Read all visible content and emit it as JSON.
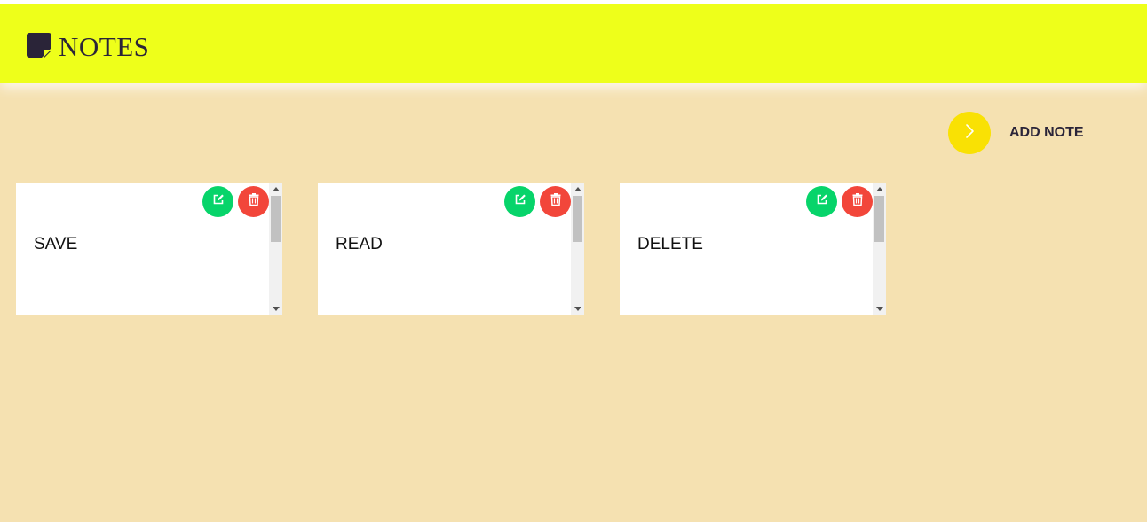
{
  "header": {
    "title": "NOTES",
    "background_color": "#eeff1a",
    "logo_icon": "sticky-note-icon"
  },
  "add_note": {
    "label": "ADD NOTE",
    "icon": "chevron-right-icon",
    "button_color": "#f9e104"
  },
  "notes": [
    {
      "text": "SAVE"
    },
    {
      "text": "READ"
    },
    {
      "text": "DELETE"
    }
  ],
  "note_actions": {
    "edit_icon": "edit-icon",
    "edit_color": "#07d46a",
    "delete_icon": "trash-icon",
    "delete_color": "#f2463a"
  },
  "colors": {
    "page_background": "#f5e1b1",
    "text": "#2a2438"
  }
}
